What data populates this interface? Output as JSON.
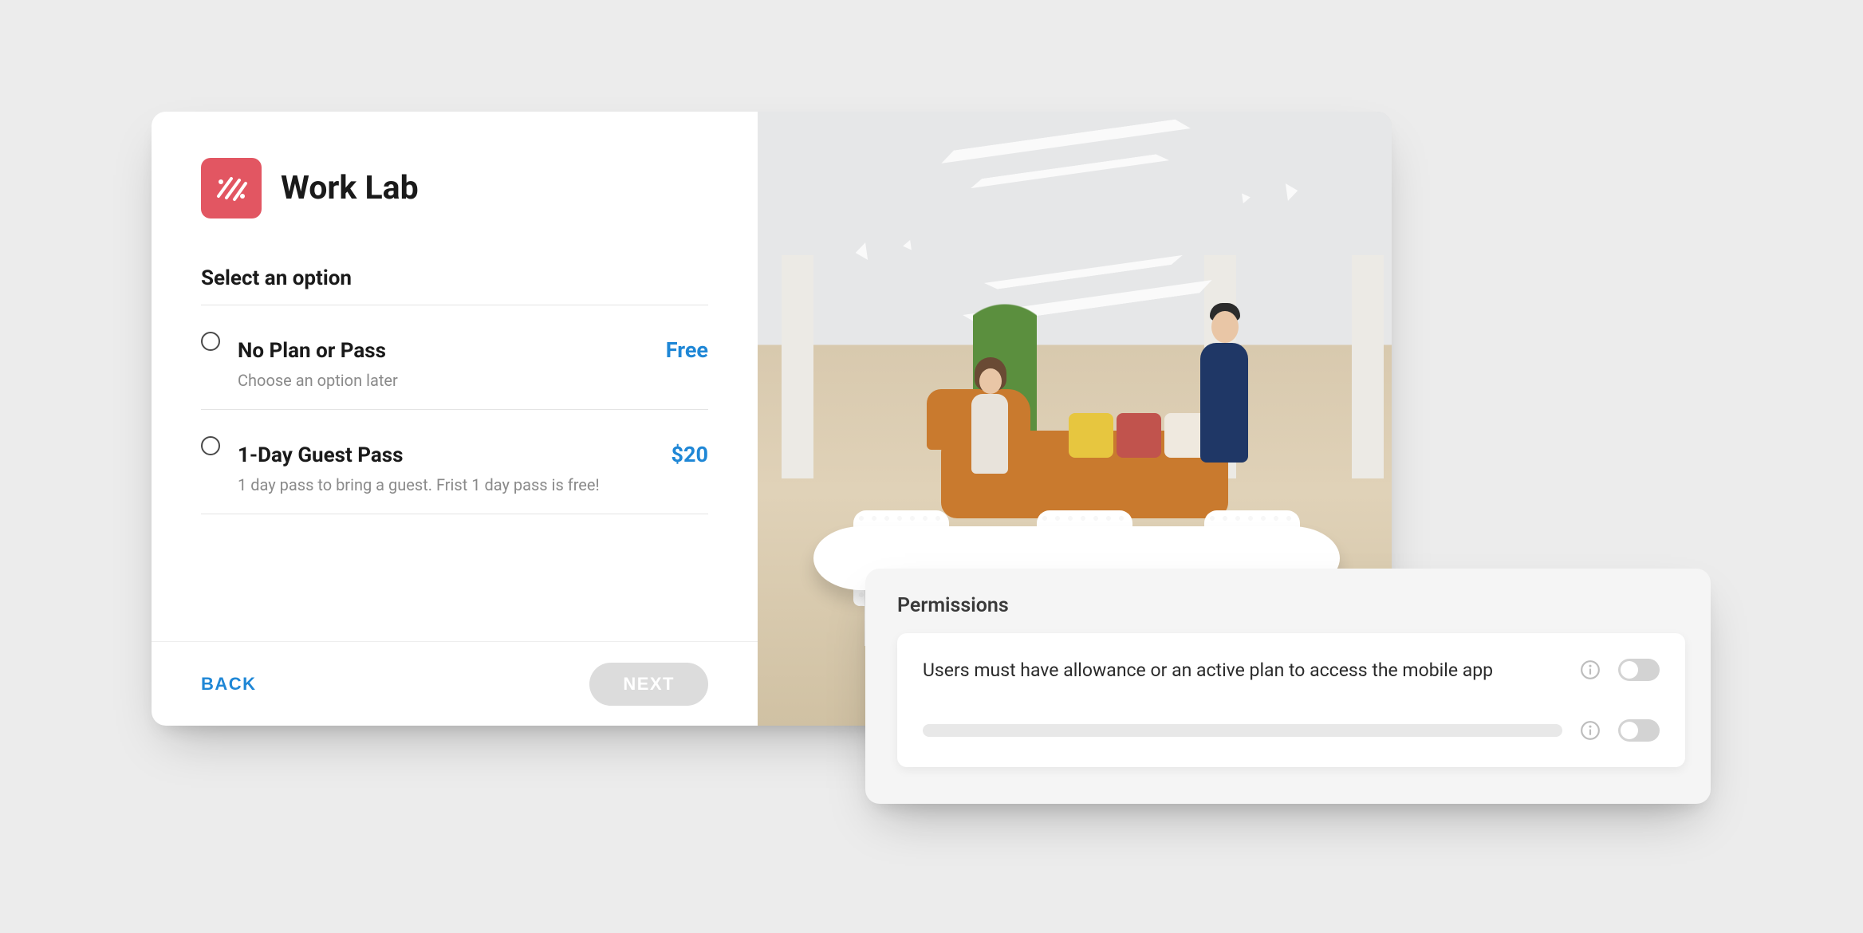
{
  "colors": {
    "accent": "#1f87d6",
    "app_icon_bg": "#e25662"
  },
  "plan_card": {
    "app_name": "Work Lab",
    "section_label": "Select an option",
    "options": [
      {
        "title": "No Plan or Pass",
        "description": "Choose an option later",
        "price": "Free"
      },
      {
        "title": "1-Day Guest Pass",
        "description": "1 day pass to bring a guest. Frist 1 day pass is free!",
        "price": "$20"
      }
    ],
    "buttons": {
      "back": "BACK",
      "next": "NEXT"
    }
  },
  "permissions_card": {
    "title": "Permissions",
    "rows": [
      {
        "label": "Users must have allowance or an active plan to access the mobile app",
        "toggle_on": false
      },
      {
        "label": "",
        "placeholder": true,
        "toggle_on": false
      }
    ]
  },
  "icons": {
    "app": "worklab-icon",
    "info": "info-icon"
  }
}
